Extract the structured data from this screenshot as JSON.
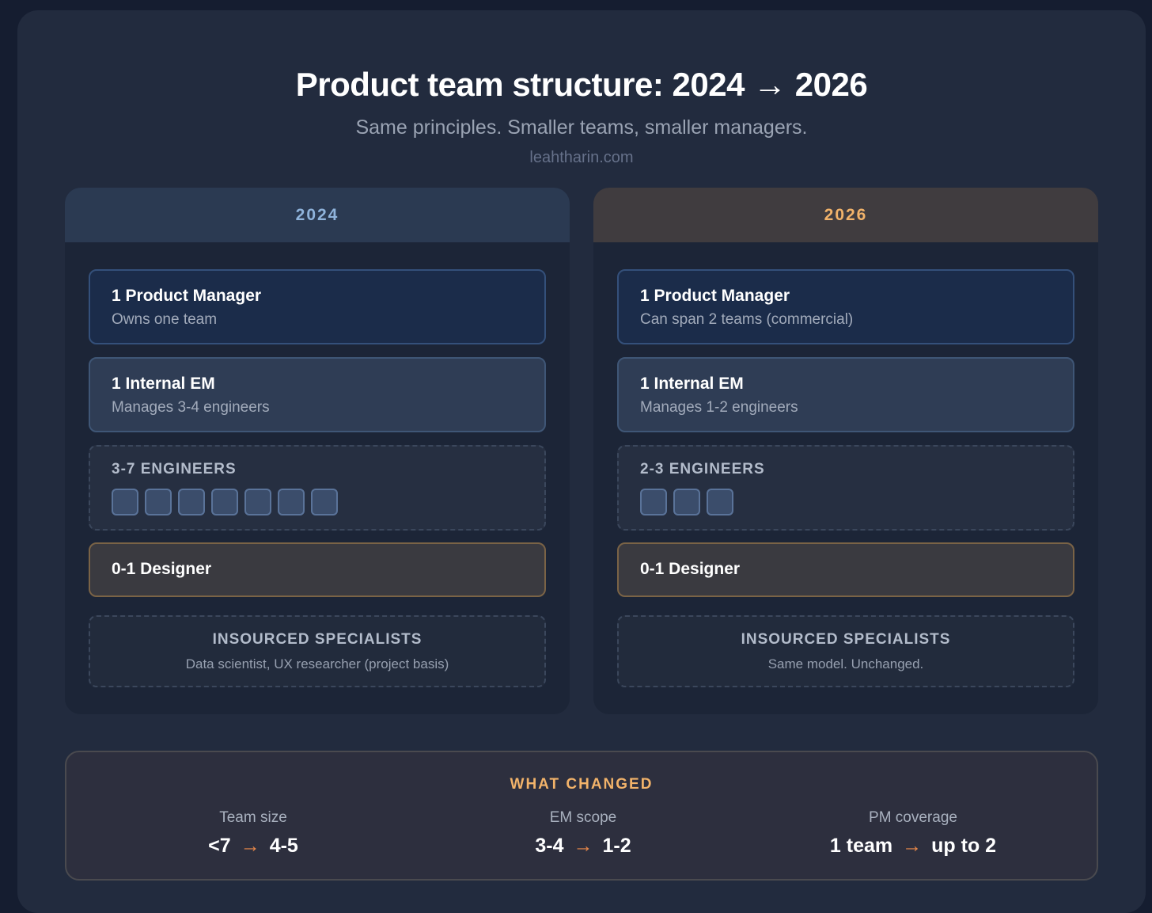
{
  "header": {
    "title": "Product team structure: 2024 → 2026",
    "subtitle": "Same principles. Smaller teams, smaller managers.",
    "site": "leahtharin.com"
  },
  "columns": [
    {
      "year": "2024",
      "pm": {
        "title": "1 Product Manager",
        "sub": "Owns one team"
      },
      "em": {
        "title": "1 Internal EM",
        "sub": "Manages 3-4 engineers"
      },
      "engineers": {
        "label": "3-7 ENGINEERS",
        "count": 7
      },
      "designer": {
        "title": "0-1 Designer"
      },
      "specialists": {
        "title": "INSOURCED SPECIALISTS",
        "sub": "Data scientist, UX researcher (project basis)"
      }
    },
    {
      "year": "2026",
      "pm": {
        "title": "1 Product Manager",
        "sub": "Can span 2 teams (commercial)"
      },
      "em": {
        "title": "1 Internal EM",
        "sub": "Manages 1-2 engineers"
      },
      "engineers": {
        "label": "2-3 ENGINEERS",
        "count": 3
      },
      "designer": {
        "title": "0-1 Designer"
      },
      "specialists": {
        "title": "INSOURCED SPECIALISTS",
        "sub": "Same model. Unchanged."
      }
    }
  ],
  "changes": {
    "title": "WHAT CHANGED",
    "arrow": "→",
    "items": [
      {
        "label": "Team size",
        "from": "<7",
        "to": "4-5"
      },
      {
        "label": "EM scope",
        "from": "3-4",
        "to": "1-2"
      },
      {
        "label": "PM coverage",
        "from": "1 team",
        "to": "up to 2"
      }
    ]
  },
  "colors": {
    "accent_orange": "#f2b36a",
    "accent_blue": "#8fb3db",
    "arrow": "#e8884a"
  }
}
